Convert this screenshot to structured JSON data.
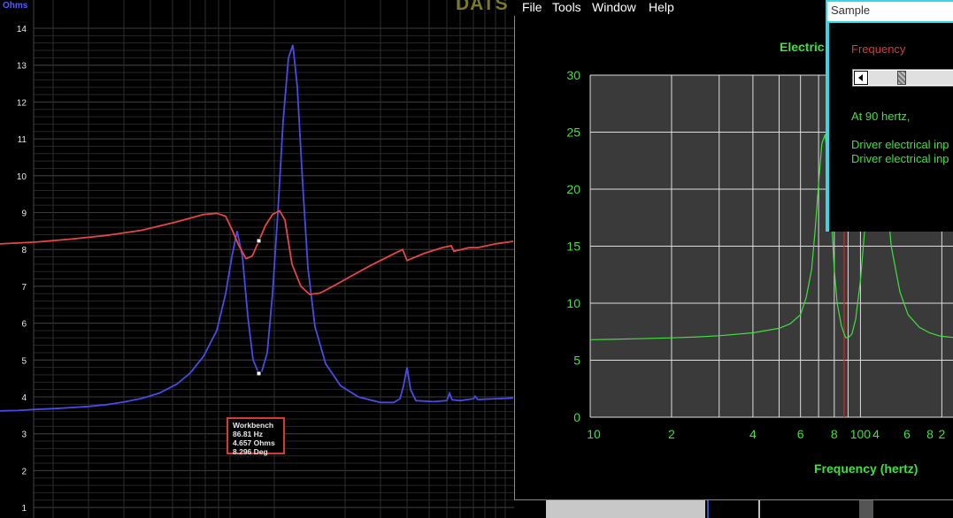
{
  "impedance_plot": {
    "ylabel": "Ohms",
    "yticks": [
      "14",
      "13",
      "12",
      "11",
      "10",
      "9",
      "8",
      "7",
      "6",
      "5",
      "4",
      "3",
      "2",
      "1"
    ],
    "brand": "DATS",
    "tooltip": {
      "title": "Workbench",
      "freq": "86.81 Hz",
      "ohms": "4.657 Ohms",
      "deg": "8.296 Deg"
    },
    "colors": {
      "impedance": "#4a4ae6",
      "phase": "#e64646",
      "grid": "#2e2e2e",
      "axis_text": "#e8e8e8"
    }
  },
  "menu": {
    "file": "File",
    "tools": "Tools",
    "window": "Window",
    "help": "Help"
  },
  "chart": {
    "title": "Electric",
    "xlabel": "Frequency (hertz)",
    "yticks": [
      "30",
      "25",
      "20",
      "15",
      "10",
      "5",
      "0"
    ],
    "xticks": [
      "10",
      "2",
      "4",
      "6",
      "8",
      "100",
      "2",
      "4",
      "6",
      "8"
    ],
    "colors": {
      "curve": "#3fe03f",
      "cursor": "#e02020",
      "grid": "#dddddd",
      "bg": "#3a3a3a"
    }
  },
  "dialog": {
    "title": "Sample",
    "frequency_label": "Frequency",
    "slider_value": 0.35,
    "at_hertz": "At 90 hertz,",
    "line1": "Driver electrical inp",
    "line2": "Driver electrical inp"
  },
  "chart_data": [
    {
      "type": "line",
      "title": "",
      "ylabel": "Ohms",
      "ylim": [
        0.8,
        14.5
      ],
      "series": [
        {
          "name": "",
          "x": [
            0,
            20,
            40,
            60,
            80,
            100,
            120,
            140,
            160,
            180,
            200,
            215,
            230,
            245,
            255,
            262,
            268,
            274,
            280,
            286,
            292,
            296,
            302,
            308,
            314,
            320,
            326,
            331,
            336,
            342,
            348,
            356,
            368,
            385,
            405,
            430,
            445,
            452,
            456,
            460,
            464,
            470,
            490,
            505,
            508,
            511,
            520,
            535,
            537,
            540,
            560,
            580
          ],
          "y": [
            3.62,
            3.63,
            3.66,
            3.68,
            3.71,
            3.74,
            3.79,
            3.86,
            3.96,
            4.1,
            4.35,
            4.65,
            5.1,
            5.8,
            6.8,
            7.8,
            8.5,
            7.8,
            6.2,
            5.0,
            4.66,
            4.7,
            5.2,
            6.8,
            9.0,
            11.5,
            13.2,
            13.55,
            12.4,
            9.8,
            7.5,
            5.9,
            4.9,
            4.3,
            4.0,
            3.85,
            3.85,
            3.95,
            4.3,
            4.8,
            4.2,
            3.9,
            3.87,
            3.9,
            4.1,
            3.92,
            3.9,
            3.95,
            4.02,
            3.93,
            3.95,
            3.97
          ]
        },
        {
          "name": "",
          "x": [
            0,
            40,
            80,
            120,
            160,
            200,
            230,
            245,
            255,
            262,
            270,
            278,
            285,
            292,
            300,
            308,
            316,
            322,
            330,
            340,
            350,
            362,
            380,
            400,
            420,
            440,
            455,
            460,
            465,
            480,
            500,
            510,
            513,
            530,
            540,
            560,
            580
          ],
          "y": [
            8.15,
            8.2,
            8.28,
            8.38,
            8.52,
            8.75,
            8.95,
            8.98,
            8.9,
            8.55,
            8.1,
            7.75,
            7.82,
            8.2,
            8.65,
            8.95,
            9.05,
            8.8,
            7.6,
            7.0,
            6.78,
            6.82,
            7.05,
            7.32,
            7.58,
            7.82,
            8.0,
            7.7,
            7.75,
            7.9,
            8.05,
            8.1,
            7.95,
            8.05,
            8.05,
            8.15,
            8.22
          ]
        }
      ]
    },
    {
      "type": "line",
      "title": "Electric",
      "xlabel": "Frequency (hertz)",
      "x_scale": "log",
      "xlim": [
        10,
        220
      ],
      "ylim": [
        0,
        30
      ],
      "cursor_x": 87,
      "series": [
        {
          "name": "",
          "x": [
            10,
            12,
            15,
            20,
            25,
            30,
            40,
            50,
            55,
            60,
            63,
            66,
            68,
            70,
            72,
            74,
            76,
            78,
            80,
            82,
            85,
            88,
            90,
            93,
            96,
            100,
            105,
            110,
            115,
            120,
            125,
            130,
            140,
            150,
            165,
            180,
            195,
            200,
            210,
            220
          ],
          "y": [
            6.8,
            6.83,
            6.88,
            6.96,
            7.05,
            7.15,
            7.4,
            7.8,
            8.2,
            9.0,
            10.5,
            13.0,
            16.5,
            20.5,
            24.0,
            24.8,
            22.0,
            17.5,
            13.0,
            10.0,
            8.0,
            7.0,
            6.95,
            7.3,
            8.6,
            12.0,
            18.0,
            23.5,
            24.9,
            23.8,
            19.5,
            15.0,
            11.0,
            9.0,
            7.9,
            7.4,
            7.15,
            7.1,
            7.05,
            7.0
          ]
        }
      ]
    }
  ]
}
